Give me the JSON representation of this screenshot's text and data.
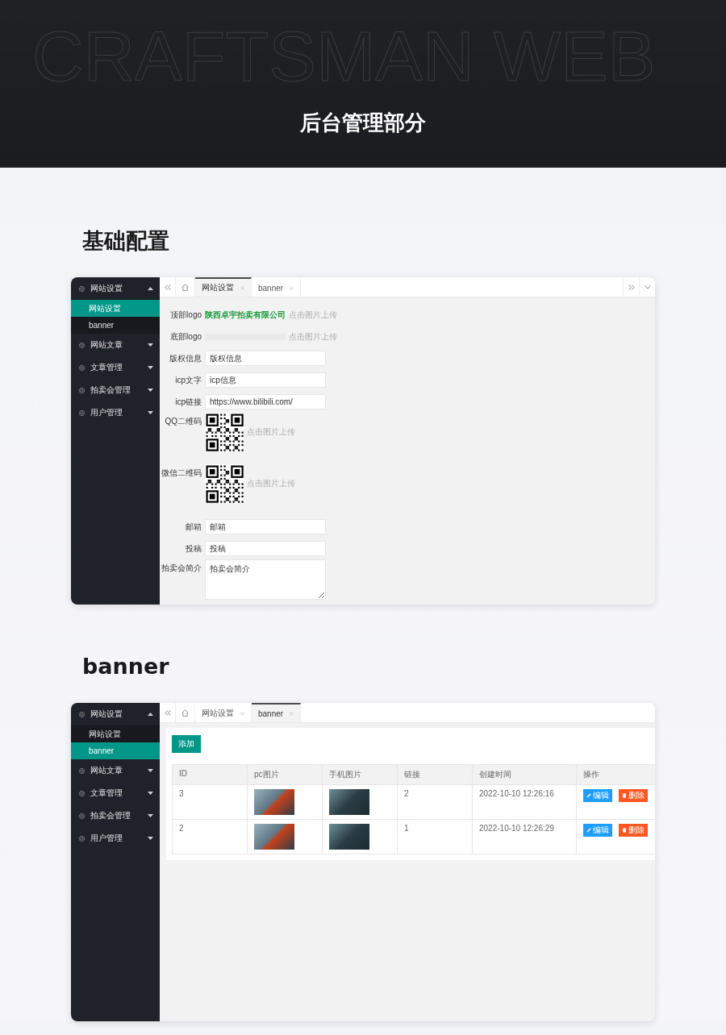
{
  "hero": {
    "background_text": "CRAFTSMAN WEB",
    "title": "后台管理部分"
  },
  "sections": [
    {
      "heading": "基础配置",
      "kind": "form",
      "sidebar": [
        {
          "label": "网站设置",
          "expanded": true,
          "children": [
            {
              "label": "网站设置",
              "selected": true
            },
            {
              "label": "banner",
              "selected": false
            }
          ]
        },
        {
          "label": "网站文章",
          "expanded": false
        },
        {
          "label": "文章管理",
          "expanded": false
        },
        {
          "label": "拍卖会管理",
          "expanded": false
        },
        {
          "label": "用户管理",
          "expanded": false
        }
      ],
      "tabs": [
        {
          "label": "网站设置",
          "selected": true
        },
        {
          "label": "banner",
          "selected": false
        }
      ],
      "fields": [
        {
          "kind": "logo",
          "label": "顶部logo",
          "logo_text": "陕西卓宇拍卖有限公司",
          "color": "#1a9a3a",
          "hint": "点击图片上传"
        },
        {
          "kind": "logo",
          "label": "底部logo",
          "hint": "点击图片上传"
        },
        {
          "kind": "text",
          "label": "版权信息",
          "value": "版权信息"
        },
        {
          "kind": "text",
          "label": "icp文字",
          "value": "icp信息"
        },
        {
          "kind": "text",
          "label": "icp链接",
          "value": "https://www.bilibili.com/"
        },
        {
          "kind": "qr",
          "label": "QQ二维码",
          "hint": "点击图片上传"
        },
        {
          "kind": "qr",
          "label": "微信二维码",
          "hint": "点击图片上传"
        },
        {
          "kind": "text",
          "label": "邮箱",
          "value": "邮箱"
        },
        {
          "kind": "text",
          "label": "投稿",
          "value": "投稿"
        },
        {
          "kind": "textarea",
          "label": "拍卖会简介",
          "value": "拍卖会简介"
        }
      ]
    },
    {
      "heading": "banner",
      "kind": "table",
      "sidebar": [
        {
          "label": "网站设置",
          "expanded": true,
          "children": [
            {
              "label": "网站设置",
              "selected": false
            },
            {
              "label": "banner",
              "selected": true
            }
          ]
        },
        {
          "label": "网站文章",
          "expanded": false
        },
        {
          "label": "文章管理",
          "expanded": false
        },
        {
          "label": "拍卖会管理",
          "expanded": false
        },
        {
          "label": "用户管理",
          "expanded": false
        }
      ],
      "tabs": [
        {
          "label": "网站设置",
          "selected": false
        },
        {
          "label": "banner",
          "selected": true
        }
      ],
      "add_button": "添加",
      "table": {
        "columns": [
          "ID",
          "pc图片",
          "手机图片",
          "链接",
          "创建时间",
          "操作"
        ],
        "rows": [
          {
            "cells": [
              {
                "kind": "text",
                "text": "3"
              },
              {
                "kind": "image"
              },
              {
                "kind": "image"
              },
              {
                "kind": "text",
                "text": "2"
              },
              {
                "kind": "text",
                "text": "2022-10-10 12:26:16"
              },
              {
                "kind": "actions",
                "buttons": [
                  {
                    "kind": "edit",
                    "label": "编辑"
                  },
                  {
                    "kind": "delete",
                    "label": "删除"
                  }
                ]
              }
            ]
          },
          {
            "cells": [
              {
                "kind": "text",
                "text": "2"
              },
              {
                "kind": "image"
              },
              {
                "kind": "image"
              },
              {
                "kind": "text",
                "text": "1"
              },
              {
                "kind": "text",
                "text": "2022-10-10 12:26:29"
              },
              {
                "kind": "actions",
                "buttons": [
                  {
                    "kind": "edit",
                    "label": "编辑"
                  },
                  {
                    "kind": "delete",
                    "label": "删除"
                  }
                ]
              }
            ]
          }
        ]
      }
    }
  ]
}
